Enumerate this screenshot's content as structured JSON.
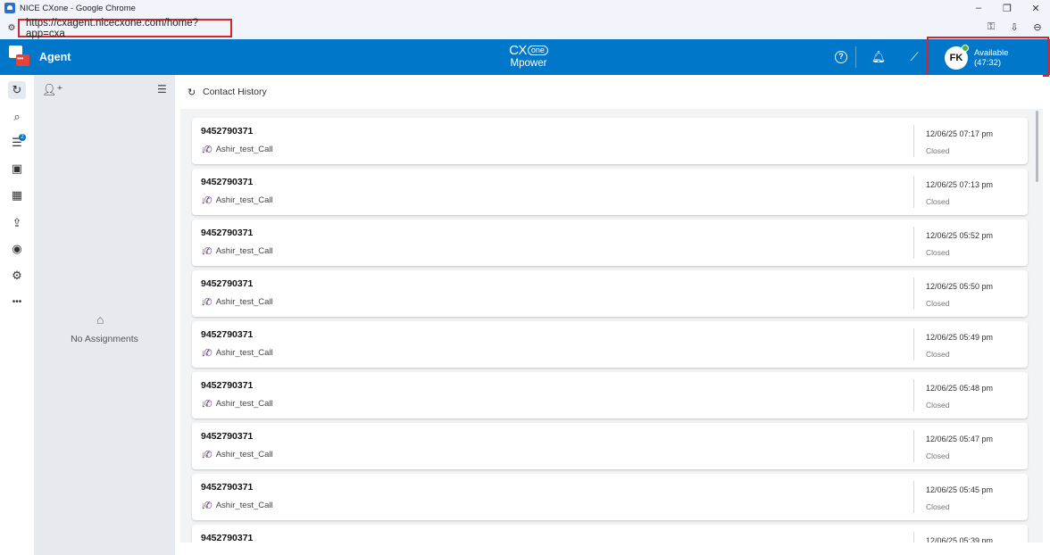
{
  "window": {
    "title": "NICE CXone - Google Chrome",
    "controls": {
      "minimize": "–",
      "restore": "❐",
      "close": "✕"
    }
  },
  "browser": {
    "url": "https://cxagent.nicecxone.com/home?app=cxa",
    "site_icon": "tune-icon",
    "right_icons": [
      "key-icon",
      "install-app-icon",
      "zoom-icon"
    ]
  },
  "header": {
    "app_title": "Agent",
    "brand_cx": "CX",
    "brand_one": "one",
    "brand_mpower": "Mpower",
    "avatar_initials": "FK",
    "status": "Available",
    "status_timer": "(47:32)",
    "colors": {
      "bar": "#0077c8",
      "status_dot": "#3fb549",
      "highlight": "#d6262b"
    }
  },
  "rail": {
    "items": [
      {
        "name": "history-icon",
        "glyph": "↻"
      },
      {
        "name": "search-icon",
        "glyph": "⌕"
      },
      {
        "name": "queue-icon",
        "glyph": "☰",
        "badge": "2"
      },
      {
        "name": "directory-icon",
        "glyph": "▣"
      },
      {
        "name": "calendar-icon",
        "glyph": "▦"
      },
      {
        "name": "share-icon",
        "glyph": "⇪"
      },
      {
        "name": "agent-profile-icon",
        "glyph": "◉"
      },
      {
        "name": "settings-icon",
        "glyph": "⚙"
      },
      {
        "name": "more-icon",
        "glyph": "•••"
      }
    ]
  },
  "assignments": {
    "empty_text": "No Assignments"
  },
  "contact_history": {
    "title": "Contact History",
    "items": [
      {
        "number": "9452790371",
        "skill": "Ashir_test_Call",
        "datetime": "12/06/25 07:17 pm",
        "status": "Closed"
      },
      {
        "number": "9452790371",
        "skill": "Ashir_test_Call",
        "datetime": "12/06/25 07:13 pm",
        "status": "Closed"
      },
      {
        "number": "9452790371",
        "skill": "Ashir_test_Call",
        "datetime": "12/06/25 05:52 pm",
        "status": "Closed"
      },
      {
        "number": "9452790371",
        "skill": "Ashir_test_Call",
        "datetime": "12/06/25 05:50 pm",
        "status": "Closed"
      },
      {
        "number": "9452790371",
        "skill": "Ashir_test_Call",
        "datetime": "12/06/25 05:49 pm",
        "status": "Closed"
      },
      {
        "number": "9452790371",
        "skill": "Ashir_test_Call",
        "datetime": "12/06/25 05:48 pm",
        "status": "Closed"
      },
      {
        "number": "9452790371",
        "skill": "Ashir_test_Call",
        "datetime": "12/06/25 05:47 pm",
        "status": "Closed"
      },
      {
        "number": "9452790371",
        "skill": "Ashir_test_Call",
        "datetime": "12/06/25 05:45 pm",
        "status": "Closed"
      },
      {
        "number": "9452790371",
        "skill": "",
        "datetime": "12/06/25 05:39 pm",
        "status": ""
      }
    ]
  }
}
